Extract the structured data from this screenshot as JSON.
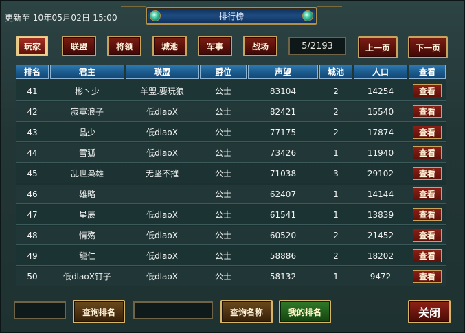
{
  "header": {
    "update_text": "更新至 10年05月02日 15:00",
    "title": "排行榜"
  },
  "tabs": [
    {
      "label": "玩家",
      "active": true
    },
    {
      "label": "联盟",
      "active": false
    },
    {
      "label": "将领",
      "active": false
    },
    {
      "label": "城池",
      "active": false
    },
    {
      "label": "军事",
      "active": false
    },
    {
      "label": "战场",
      "active": false
    }
  ],
  "pagination": {
    "page_indicator": "5/2193",
    "prev_label": "上一页",
    "next_label": "下一页"
  },
  "table": {
    "columns": [
      "排名",
      "君主",
      "联盟",
      "爵位",
      "声望",
      "城池",
      "人口",
      "查看"
    ],
    "view_label": "查看",
    "rows": [
      [
        "41",
        "彬丶少",
        "羊盟.要玩狼",
        "公士",
        "83104",
        "2",
        "14254"
      ],
      [
        "42",
        "寂寞浪子",
        "低dlaoX",
        "公士",
        "82421",
        "2",
        "15540"
      ],
      [
        "43",
        "晶少",
        "低dlaoX",
        "公士",
        "77175",
        "2",
        "17874"
      ],
      [
        "44",
        "雪狐",
        "低dlaoX",
        "公士",
        "73426",
        "1",
        "11940"
      ],
      [
        "45",
        "乱世枭雄",
        "无坚不摧",
        "公士",
        "71038",
        "3",
        "29102"
      ],
      [
        "46",
        "雄略",
        "",
        "公士",
        "62407",
        "1",
        "14144"
      ],
      [
        "47",
        "星辰",
        "低dlaoX",
        "公士",
        "61541",
        "1",
        "13839"
      ],
      [
        "48",
        "情殇",
        "低dlaoX",
        "公士",
        "60520",
        "2",
        "21452"
      ],
      [
        "49",
        "龍仁",
        "低dlaoX",
        "公士",
        "58886",
        "2",
        "18202"
      ],
      [
        "50",
        "低dlaoX钉子",
        "低dlaoX",
        "公士",
        "58132",
        "1",
        "9472"
      ]
    ]
  },
  "footer": {
    "rank_input_value": "",
    "query_rank_label": "查询排名",
    "name_input_value": "",
    "query_name_label": "查询名称",
    "my_rank_label": "我的排名",
    "close_label": "关闭"
  },
  "colors": {
    "tab_red": "#7a1d14",
    "header_blue": "#1c5c8f",
    "gold_border": "#c7a35e",
    "my_rank_green": "#2f7a2a"
  }
}
